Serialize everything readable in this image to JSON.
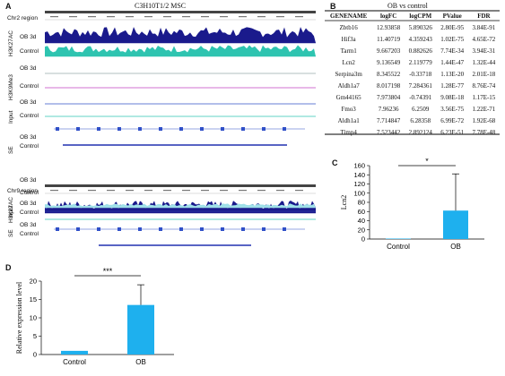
{
  "panel_a": {
    "label": "A",
    "title": "C3H10T1/2 MSC",
    "region1": "Chr2 region",
    "region2": "Chr9 region",
    "group_h3k27ac": "H3K27AC",
    "group_h3k9me3": "H3K9Me3",
    "group_input": "Input",
    "group_se": "SE",
    "track_ob": "OB 3d",
    "track_control": "Control",
    "colors": {
      "navy": "#1a1a8c",
      "teal": "#2ec4b0",
      "magenta": "#c040c0",
      "blue": "#3050c8",
      "light": "#9fe0e8"
    }
  },
  "panel_b": {
    "label": "B",
    "title": "OB vs control",
    "headers": [
      "GENENAME",
      "logFC",
      "logCPM",
      "PValue",
      "FDR"
    ],
    "rows": [
      [
        "Zbtb16",
        "12.93858",
        "5.890326",
        "2.80E-95",
        "3.84E-91"
      ],
      [
        "Hif3a",
        "11.40719",
        "4.359243",
        "1.02E-75",
        "4.65E-72"
      ],
      [
        "Tarm1",
        "9.667203",
        "0.882626",
        "7.74E-34",
        "3.94E-31"
      ],
      [
        "Lcn2",
        "9.136549",
        "2.119779",
        "1.44E-47",
        "1.32E-44"
      ],
      [
        "Serpina3m",
        "8.345522",
        "-0.33718",
        "1.13E-20",
        "2.01E-18"
      ],
      [
        "Aldh1a7",
        "8.017198",
        "7.284361",
        "1.28E-77",
        "8.76E-74"
      ],
      [
        "Gm44165",
        "7.973804",
        "-0.74391",
        "9.08E-18",
        "1.17E-15"
      ],
      [
        "Fmo3",
        "7.96236",
        "6.2509",
        "3.56E-75",
        "1.22E-71"
      ],
      [
        "Aldh1a1",
        "7.714847",
        "6.28358",
        "6.99E-72",
        "1.92E-68"
      ],
      [
        "Timp4",
        "7.523442",
        "2.892124",
        "6.23E-51",
        "7.78E-48"
      ]
    ]
  },
  "panel_c": {
    "label": "C",
    "significance": "*",
    "chart_data": {
      "type": "bar",
      "categories": [
        "Control",
        "OB"
      ],
      "values": [
        1,
        62
      ],
      "errors": [
        0,
        80
      ],
      "ylabel": "Lcn2",
      "ylim": [
        0,
        160
      ],
      "yticks": [
        "0",
        "20",
        "40",
        "60",
        "80",
        "100",
        "120",
        "140",
        "160"
      ],
      "bar_color": "#1eb0ee"
    }
  },
  "panel_d": {
    "label": "D",
    "significance": "***",
    "chart_data": {
      "type": "bar",
      "categories": [
        "Control",
        "OB"
      ],
      "values": [
        1,
        13.5
      ],
      "errors": [
        0,
        5.5
      ],
      "ylabel": "Relative expression level",
      "ylim": [
        0,
        20
      ],
      "yticks": [
        "0",
        "5",
        "10",
        "15",
        "20"
      ],
      "bar_color": "#1eb0ee"
    }
  }
}
